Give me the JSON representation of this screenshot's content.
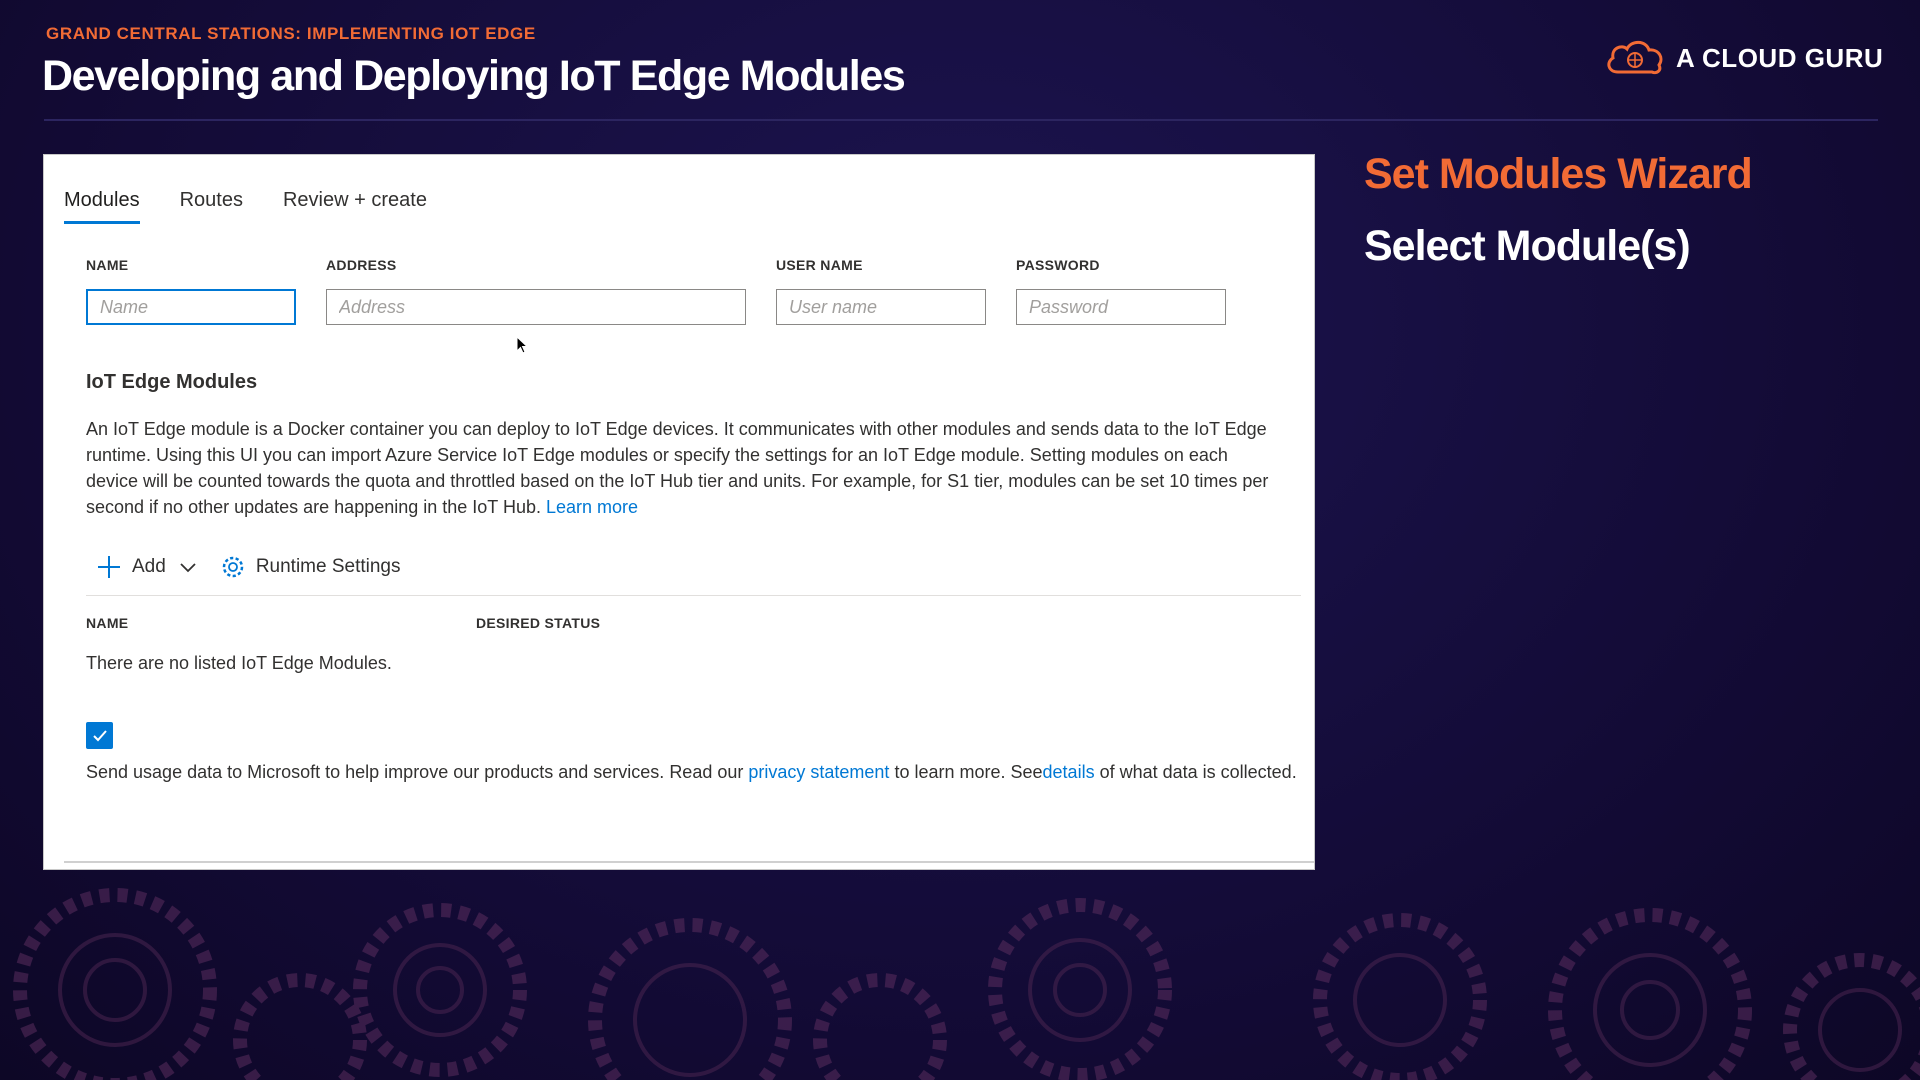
{
  "header": {
    "course": "GRAND CENTRAL STATIONS: IMPLEMENTING IOT EDGE",
    "title": "Developing and Deploying IoT Edge Modules",
    "brand": "A CLOUD GURU"
  },
  "sidebar": {
    "title": "Set Modules Wizard",
    "subtitle": "Select Module(s)"
  },
  "tabs": [
    {
      "label": "Modules",
      "active": true
    },
    {
      "label": "Routes",
      "active": false
    },
    {
      "label": "Review + create",
      "active": false
    }
  ],
  "registry": {
    "name_label": "NAME",
    "name_placeholder": "Name",
    "address_label": "ADDRESS",
    "address_placeholder": "Address",
    "username_label": "USER NAME",
    "username_placeholder": "User name",
    "password_label": "PASSWORD",
    "password_placeholder": "Password"
  },
  "modules": {
    "heading": "IoT Edge Modules",
    "description": "An IoT Edge module is a Docker container you can deploy to IoT Edge devices. It communicates with other modules and sends data to the IoT Edge runtime. Using this UI you can import Azure Service IoT Edge modules or specify the settings for an IoT Edge module. Setting modules on each device will be counted towards the quota and throttled based on the IoT Hub tier and units. For example, for S1 tier, modules can be set 10 times per second if no other updates are happening in the IoT Hub.",
    "learn_more": "Learn more",
    "add_label": "Add",
    "runtime_label": "Runtime Settings",
    "col_name": "NAME",
    "col_status": "DESIRED STATUS",
    "empty": "There are no listed IoT Edge Modules."
  },
  "consent": {
    "checked": true,
    "text_before": "Send usage data to Microsoft to help improve our products and services. Read our ",
    "privacy_link": "privacy statement",
    "text_middle": " to learn more. See",
    "details_link": "details",
    "text_after": "of what data is collected."
  },
  "colors": {
    "accent": "#0078d4",
    "brand_orange": "#f26b35",
    "background": "#150d3a"
  }
}
